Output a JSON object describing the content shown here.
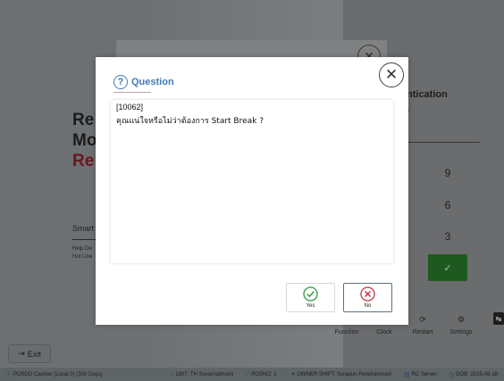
{
  "background": {
    "title_lines": [
      "Re",
      "Mo",
      "Re"
    ],
    "smart_text": "Smart",
    "help_text": "Help De",
    "hotline_text": "Hot Line",
    "auth_title": "ntication",
    "auth_subtitle": "n",
    "keypad_keys": [
      "9",
      "6",
      "3"
    ],
    "enter_symbol": "✓",
    "bottom_buttons": [
      {
        "label": "Function",
        "icon": "grid-icon"
      },
      {
        "label": "Clock",
        "icon": "clock-icon"
      },
      {
        "label": "Restart",
        "icon": "restart-icon"
      },
      {
        "label": "Settings",
        "icon": "gear-icon"
      }
    ],
    "exit_label": "Exit"
  },
  "status_bar": {
    "device": "POSDD Cashier (Local 0) (300 Days)",
    "store": "1807: TH Suvarnabhumi",
    "pos_no": "POSNO: 1",
    "owner_shift": "OWNER SHIFT: Surapun Penchamrush",
    "server": "RC Server",
    "dob": "DOB: 2025-06-18"
  },
  "dialog": {
    "title": "Question",
    "code": "[10062]",
    "message": "คุณแน่ใจหรือไม่ว่าต้องการ Start Break ?",
    "yes_label": "Yes",
    "no_label": "No",
    "close_symbol": "✕"
  },
  "colors": {
    "accent": "#3c7cb8",
    "yes_check": "#2e9a3c",
    "no_x": "#c8303f",
    "overlay": "#5e6264"
  }
}
